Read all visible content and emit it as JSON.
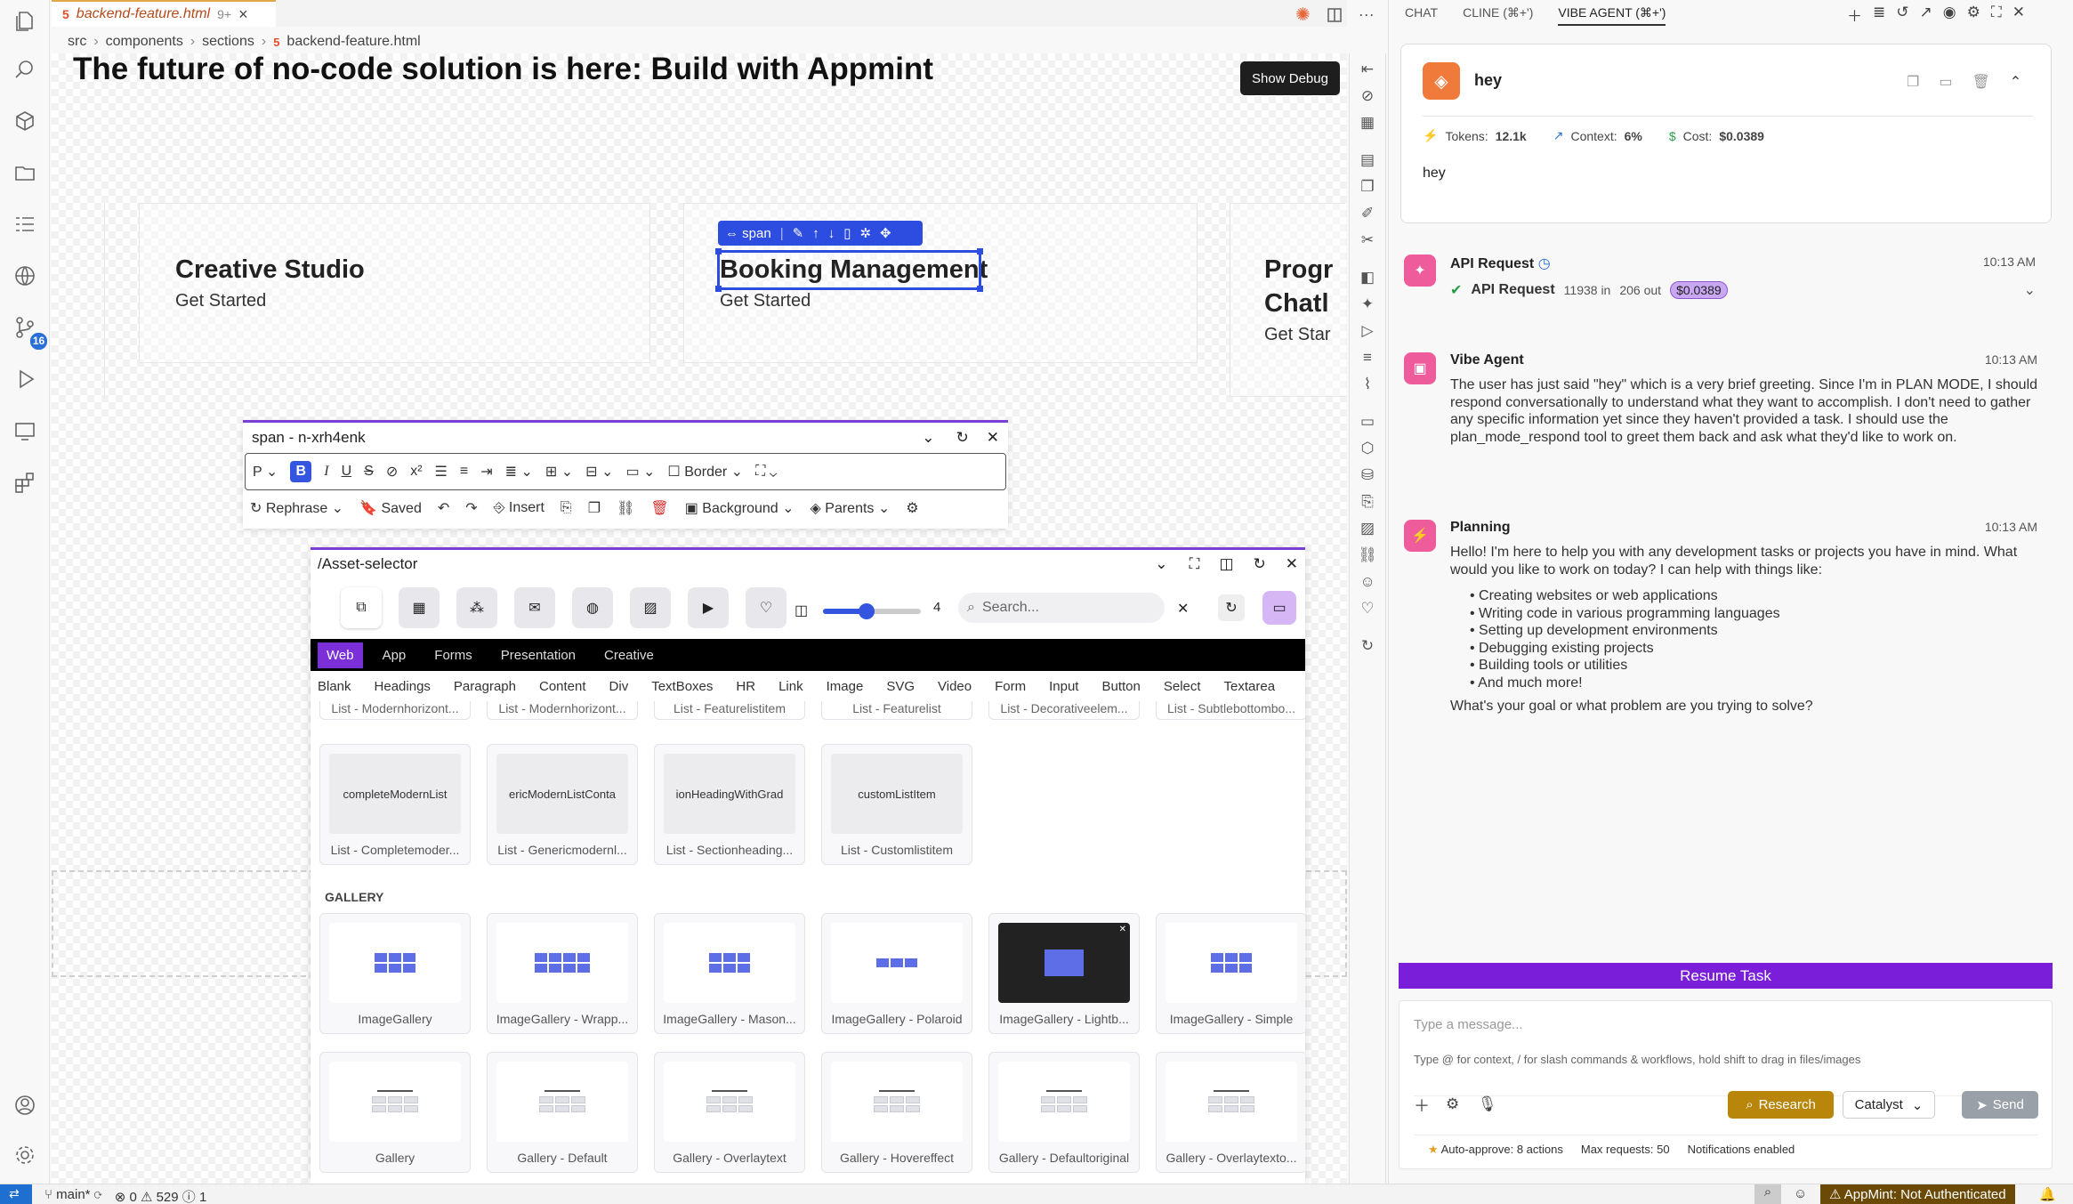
{
  "editor_tab": {
    "file": "backend-feature.html",
    "problems": "9+"
  },
  "breadcrumb": [
    "src",
    "components",
    "sections",
    "backend-feature.html"
  ],
  "activity_badge": "16",
  "canvas": {
    "headline": "The future of no-code solution is here: Build with Appmint",
    "debug_button": "Show Debug",
    "cards": [
      {
        "title": "Creative Studio",
        "sub": "Get Started"
      },
      {
        "title": "Booking Management",
        "sub": "Get Started"
      },
      {
        "title": "Progr",
        "title2": "Chatl",
        "sub": "Get Star"
      }
    ],
    "span_toolbar_label": "span"
  },
  "text_panel": {
    "selector": "span - n-xrh4enk",
    "paragraph": "P",
    "border_label": "Border",
    "actions": [
      "Rephrase",
      "Saved",
      "Insert",
      "Background",
      "Parents"
    ]
  },
  "asset_selector": {
    "path": "/Asset-selector",
    "slider_value": "4",
    "search_placeholder": "Search...",
    "categories": [
      "Web",
      "App",
      "Forms",
      "Presentation",
      "Creative"
    ],
    "types": [
      "Blank",
      "Headings",
      "Paragraph",
      "Content",
      "Div",
      "TextBoxes",
      "HR",
      "Link",
      "Image",
      "SVG",
      "Video",
      "Form",
      "Input",
      "Button",
      "Select",
      "Textarea"
    ],
    "top_labels": [
      "List - Modernhorizont...",
      "List - Modernhorizont...",
      "List - Featurelistitem",
      "List - Featurelist",
      "List - Decorativeelem...",
      "List - Subtlebottombo..."
    ],
    "list_tiles": [
      {
        "preview": "completeModernList",
        "label": "List - Completemoder..."
      },
      {
        "preview": "ericModernListConta",
        "label": "List - Genericmodernl..."
      },
      {
        "preview": "ionHeadingWithGrad",
        "label": "List - Sectionheading..."
      },
      {
        "preview": "customListItem",
        "label": "List - Customlistitem"
      }
    ],
    "section_gallery": "GALLERY",
    "gallery_row1": [
      "ImageGallery",
      "ImageGallery - Wrapp...",
      "ImageGallery - Mason...",
      "ImageGallery - Polaroid",
      "ImageGallery - Lightb...",
      "ImageGallery - Simple"
    ],
    "gallery_row2": [
      "Gallery",
      "Gallery - Default",
      "Gallery - Overlaytext",
      "Gallery - Hovereffect",
      "Gallery - Defaultoriginal",
      "Gallery - Overlaytexto..."
    ]
  },
  "right_panel": {
    "tabs": [
      "CHAT",
      "CLINE (⌘+')",
      "VIBE AGENT (⌘+')"
    ],
    "task": {
      "title": "hey",
      "tokens_label": "Tokens:",
      "tokens": "12.1k",
      "context_label": "Context:",
      "context": "6%",
      "cost_label": "Cost:",
      "cost": "$0.0389",
      "body": "hey"
    },
    "api_request": {
      "title": "API Request",
      "time": "10:13 AM",
      "line_title": "API Request",
      "in": "11938 in",
      "out": "206 out",
      "cost": "$0.0389"
    },
    "vibe_agent": {
      "title": "Vibe Agent",
      "time": "10:13 AM",
      "text": "The user has just said \"hey\" which is a very brief greeting. Since I'm in PLAN MODE, I should respond conversationally to understand what they want to accomplish. I don't need to gather any specific information yet since they haven't provided a task. I should use the plan_mode_respond tool to greet them back and ask what they'd like to work on."
    },
    "planning": {
      "title": "Planning",
      "time": "10:13 AM",
      "intro": "Hello! I'm here to help you with any development tasks or projects you have in mind. What would you like to work on today? I can help with things like:",
      "bullets": [
        "Creating websites or web applications",
        "Writing code in various programming languages",
        "Setting up development environments",
        "Debugging existing projects",
        "Building tools or utilities",
        "And much more!"
      ],
      "question": "What's your goal or what problem are you trying to solve?"
    },
    "resume_button": "Resume Task",
    "input_placeholder": "Type a message...",
    "input_hint": "Type @ for context, / for slash commands & workflows, hold shift to drag in files/images",
    "research_button": "Research",
    "model": "Catalyst",
    "send_button": "Send",
    "auto_approve": "Auto-approve: 8 actions",
    "max_requests": "Max requests: 50",
    "notifications": "Notifications enabled"
  },
  "status_bar": {
    "branch": "main*",
    "errors": "0",
    "warnings": "529",
    "info": "1",
    "auth": "AppMint: Not Authenticated"
  }
}
